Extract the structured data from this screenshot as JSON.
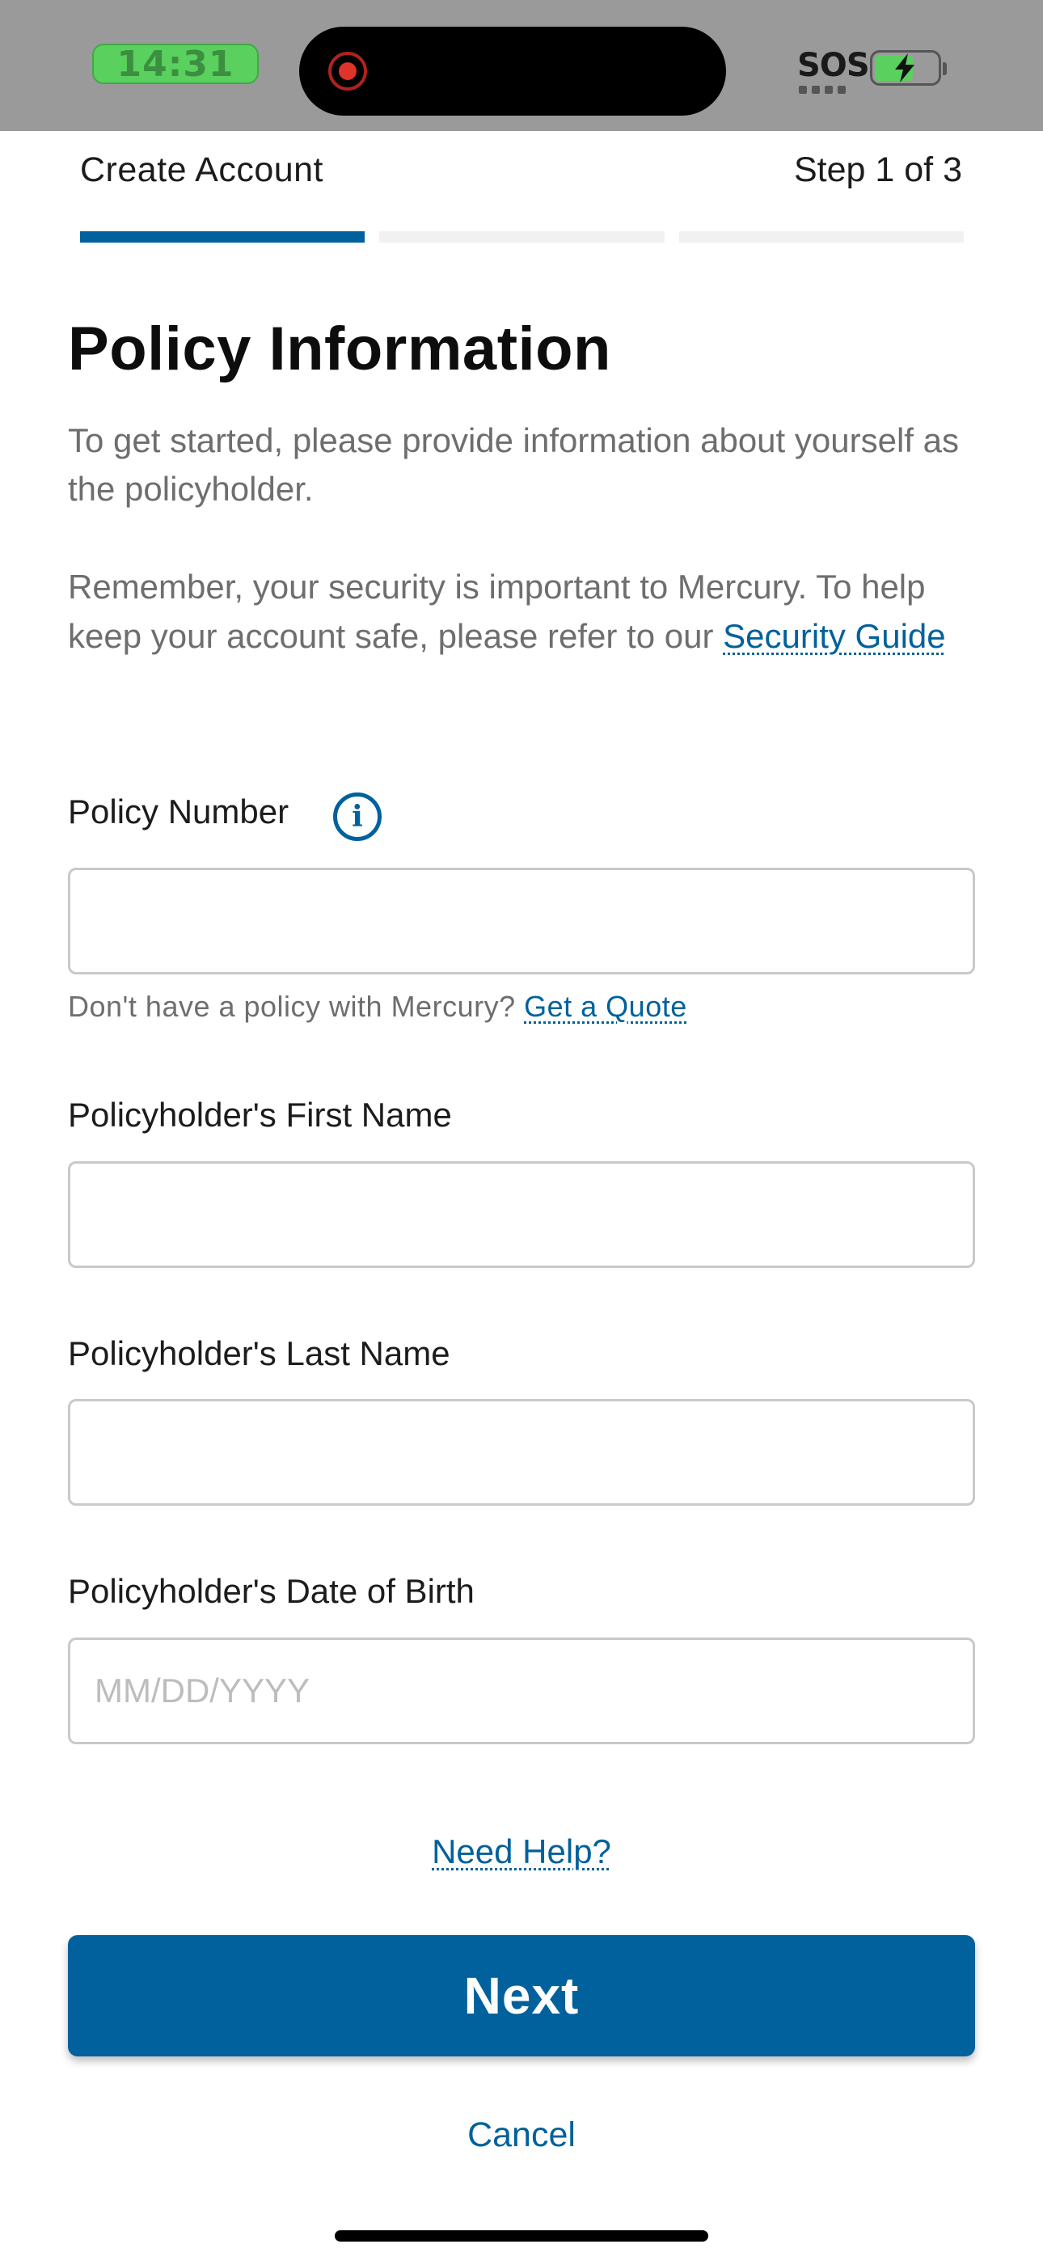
{
  "status_bar": {
    "time": "14:31",
    "sos": "SOS",
    "battery_level": 0.62,
    "icons": [
      "screen-recording-icon",
      "battery-charging-icon"
    ],
    "colors": {
      "time_pill": "#5ad05e",
      "background": "#9a9a9a"
    }
  },
  "header": {
    "title": "Create Account",
    "step": "Step 1 of 3",
    "progress_steps_total": 3,
    "progress_steps_complete": 1
  },
  "main": {
    "title": "Policy Information",
    "intro": "To get started, please provide information about yourself as the policyholder.",
    "security_text": "Remember, your security is important to Mercury. To help keep your account safe, please refer to our",
    "security_link": "Security Guide",
    "fields": {
      "policy_number": {
        "label": "Policy Number",
        "value": "",
        "placeholder": ""
      },
      "first_name": {
        "label": "Policyholder's First Name",
        "value": "",
        "placeholder": ""
      },
      "last_name": {
        "label": "Policyholder's Last Name",
        "value": "",
        "placeholder": ""
      },
      "dob": {
        "label": "Policyholder's Date of Birth",
        "value": "",
        "placeholder": "MM/DD/YYYY"
      }
    },
    "quote_helper": "Don't have a policy with Mercury?",
    "quote_link": "Get a Quote",
    "need_help": "Need Help?",
    "next_label": "Next",
    "cancel_label": "Cancel"
  },
  "colors": {
    "accent": "#00619c",
    "muted_text": "#6e6e6e",
    "border": "#c9c9c9"
  }
}
